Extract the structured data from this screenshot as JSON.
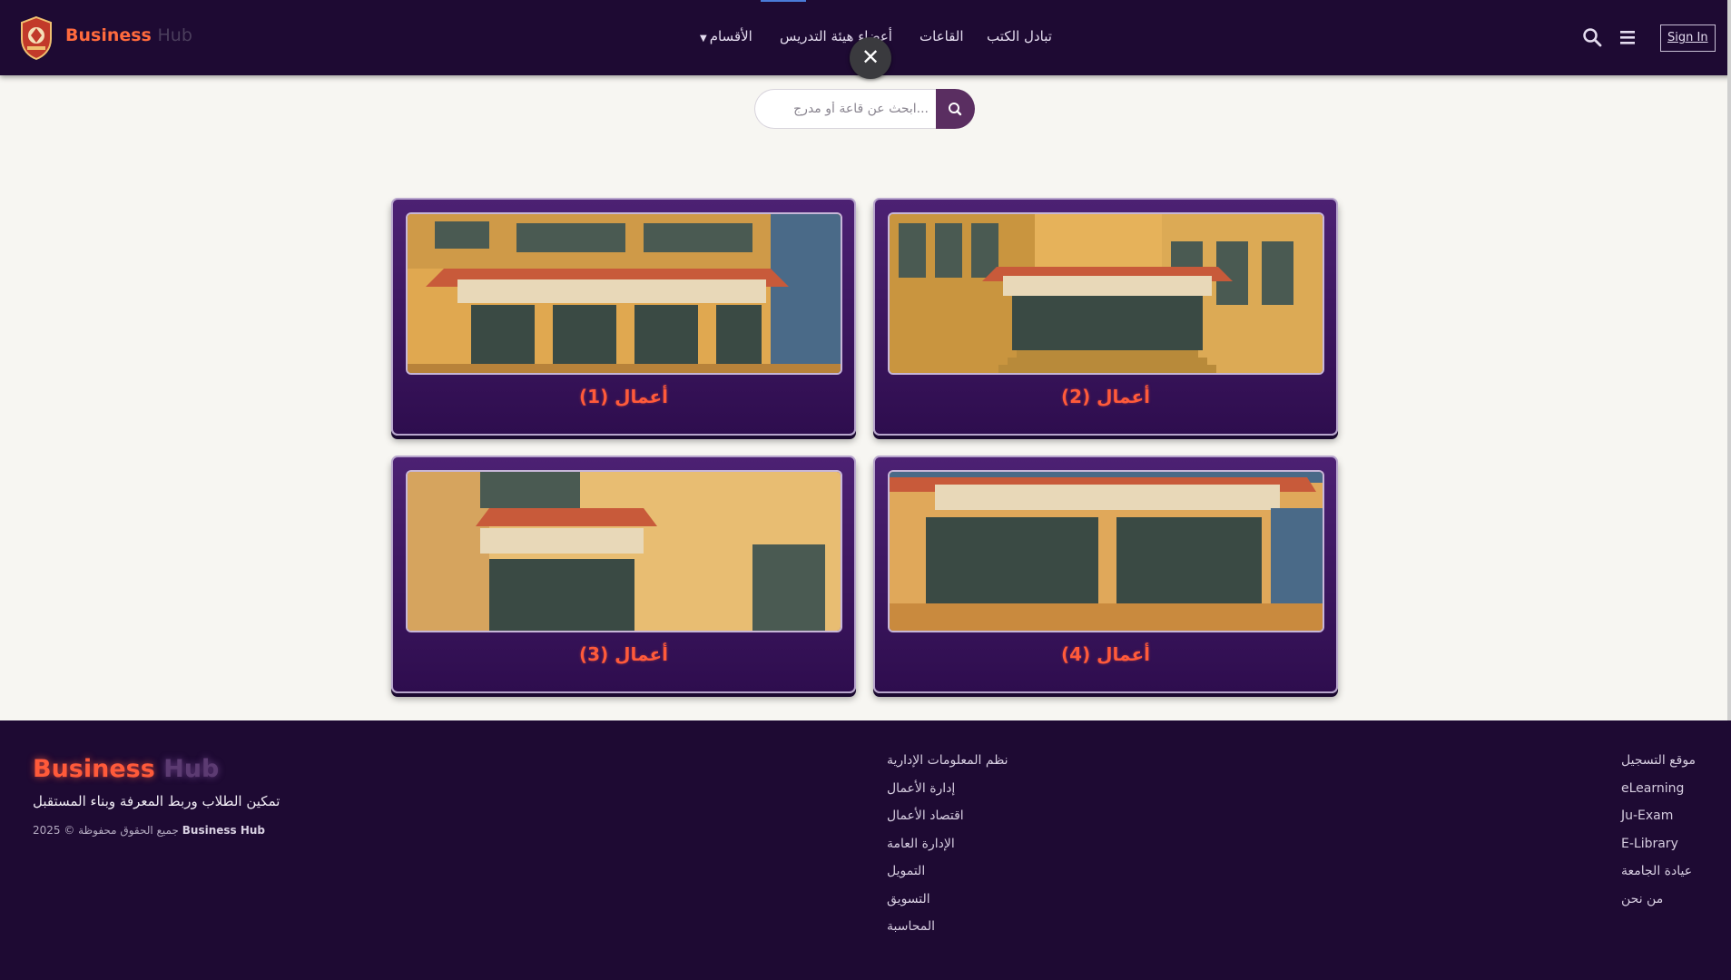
{
  "navbar": {
    "brand_part1": "Business",
    "brand_part2": "Hub",
    "links": [
      "تبادل الكتب",
      "القاعات",
      "أعضاء هيئة التدريس",
      "الأقسام"
    ],
    "sign_in_label": "Sign In",
    "close_label": "✕"
  },
  "search": {
    "placeholder": "...ابحث عن قاعة أو مدرج"
  },
  "cards": [
    {
      "title": "أعمال (1)"
    },
    {
      "title": "أعمال (2)"
    },
    {
      "title": "أعمال (3)"
    },
    {
      "title": "أعمال (4)"
    }
  ],
  "footer": {
    "brand_part1": "Business",
    "brand_part2": "Hub",
    "tagline": "تمكين الطلاب وربط المعرفة وبناء المستقبل",
    "copyright_brand": "Business Hub",
    "copyright_text": "جميع الحقوق محفوظة © 2025",
    "departments": [
      "نظم المعلومات الإدارية",
      "إدارة الأعمال",
      "اقتصاد الأعمال",
      "الإدارة العامة",
      "التمويل",
      "التسويق",
      "المحاسبة"
    ],
    "links": [
      "موقع التسجيل",
      "eLearning",
      "Ju-Exam",
      "E-Library",
      "عيادة الجامعة",
      "من نحن"
    ]
  },
  "colors": {
    "navbar_bg": "#1e0a33",
    "accent": "#ff5a3a",
    "card_bg": "#3d1660",
    "search_button": "#5a2e61"
  }
}
